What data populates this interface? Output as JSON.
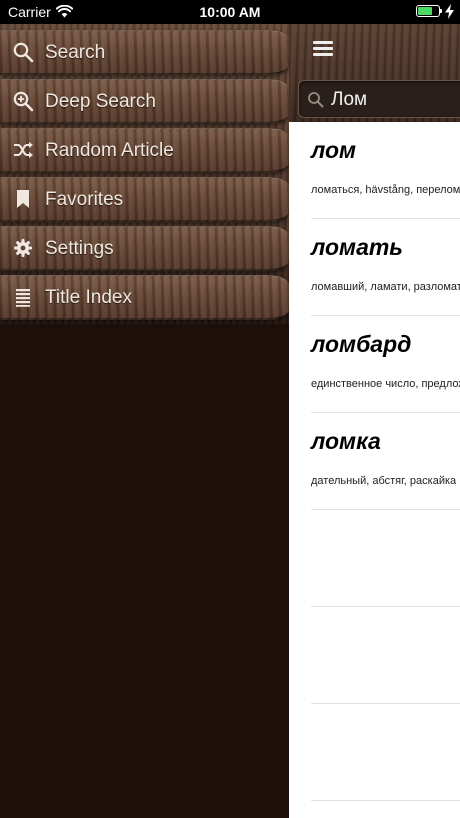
{
  "status_bar": {
    "carrier": "Carrier",
    "time": "10:00 AM",
    "battery_level": 0.72
  },
  "menu": {
    "items": [
      {
        "label": "Search",
        "icon": "search-icon"
      },
      {
        "label": "Deep Search",
        "icon": "zoom-plus-icon"
      },
      {
        "label": "Random Article",
        "icon": "shuffle-icon"
      },
      {
        "label": "Favorites",
        "icon": "bookmark-icon"
      },
      {
        "label": "Settings",
        "icon": "gear-icon"
      },
      {
        "label": "Title Index",
        "icon": "list-index-icon"
      }
    ]
  },
  "search": {
    "value": "Лом"
  },
  "results": [
    {
      "title": "лом",
      "snippet": "ломаться, hävstång, перелом"
    },
    {
      "title": "ломать",
      "snippet": "ломавший, ламати, разломать"
    },
    {
      "title": "ломбард",
      "snippet": "единственное число, предложный"
    },
    {
      "title": "ломка",
      "snippet": "дательный, абстяг, раскайка"
    }
  ],
  "colors": {
    "menu_text": "#efe7df",
    "battery": "#4cd964",
    "wood": "#6a4a38"
  }
}
